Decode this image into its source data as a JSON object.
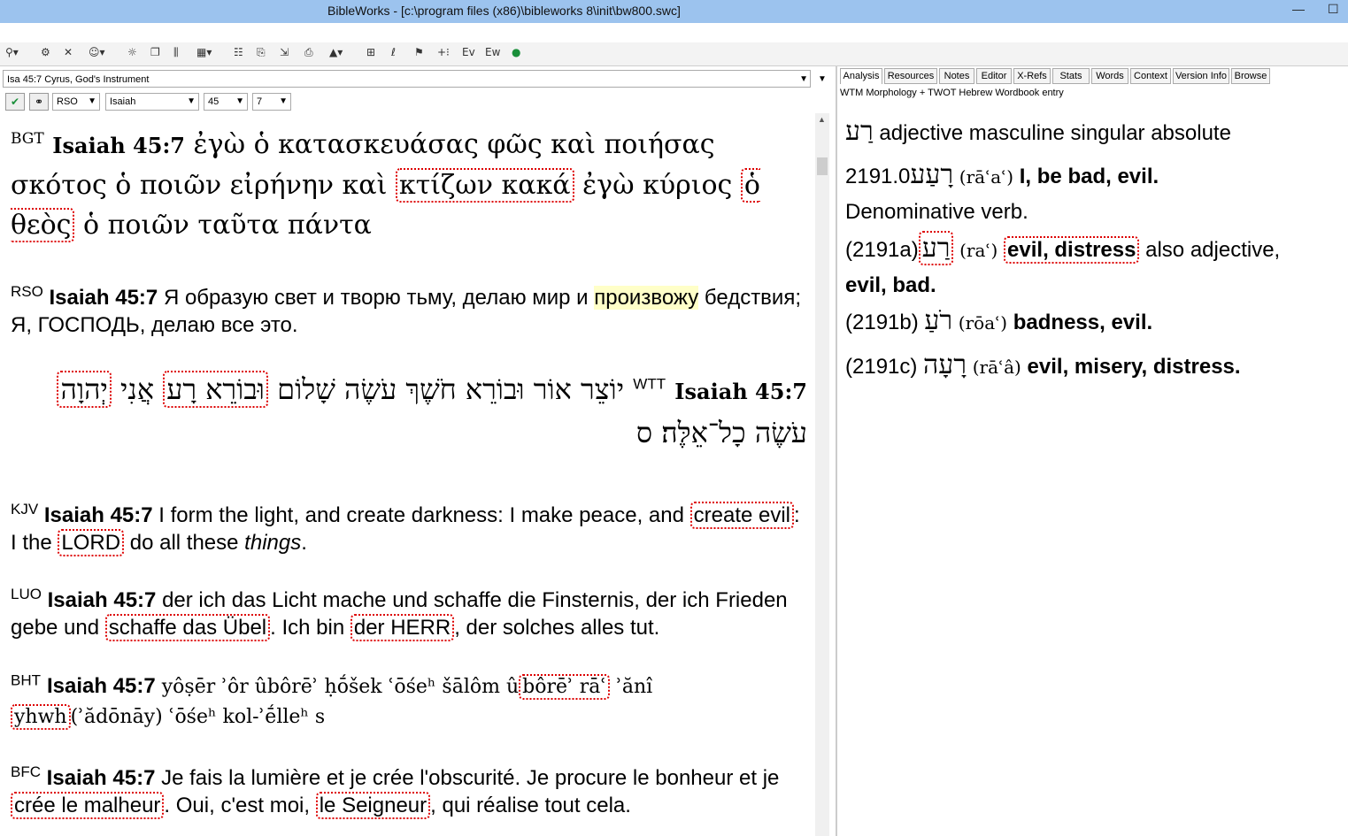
{
  "window": {
    "title": "BibleWorks - [c:\\program files (x86)\\bibleworks 8\\init\\bw800.swc]"
  },
  "reference_box": {
    "value": "Isa 45:7 Cyrus, God's Instrument"
  },
  "selectors": {
    "version": "RSO",
    "book": "Isaiah",
    "chapter": "45",
    "verse": "7"
  },
  "tabs": [
    "Analysis",
    "Resources",
    "Notes",
    "Editor",
    "X-Refs",
    "Stats",
    "Words",
    "Context",
    "Version Info",
    "Browse"
  ],
  "analysis": {
    "entry_title": "WTM Morphology + TWOT Hebrew Wordbook entry",
    "head_word": "רַע",
    "parse": "adjective masculine singular absolute",
    "l1_num": "2191.0",
    "l1_heb": "רָעַע",
    "l1_tr": "(rāʿaʿ)",
    "l1_def": "I, be bad, evil.",
    "l2": "Denominative verb.",
    "l3_num": "(2191a)",
    "l3_heb": "רַע",
    "l3_tr": "(raʿ)",
    "l3_def": "evil, distress",
    "l3_rest": " also adjective,",
    "l4": "evil, bad.",
    "l5_num": "(2191b)",
    "l5_heb": "רֹעַ",
    "l5_tr": "(rōaʿ)",
    "l5_def": "badness, evil.",
    "l6_num": "(2191c)",
    "l6_heb": "רָעָה",
    "l6_tr": "(rāʿâ)",
    "l6_def": "evil, misery, distress."
  },
  "verses": {
    "bgt": {
      "ver": "BGT",
      "ref": "Isaiah 45:7",
      "t1": "ἐγὼ ὁ κατασκευάσας φῶς καὶ ποιήσας σκότος ὁ ποιῶν εἰρήνην καὶ",
      "h1": "κτίζων κακά",
      "t2": "ἐγὼ κύριος",
      "h2": "ὁ θεὸς",
      "t3": "ὁ ποιῶν ταῦτα πάντα"
    },
    "rso": {
      "ver": "RSO",
      "ref": "Isaiah 45:7",
      "t1": "Я образую свет и творю тьму, делаю мир и",
      "y1": "произвожу",
      "t2": "бедствия; Я, ГОСПОДЬ, делаю все это."
    },
    "wtt": {
      "ver": "WTT",
      "ref": "Isaiah 45:7",
      "t1": "יוֹצֵר אוֹר וּבוֹרֵא חֹשֶׁךְ עֹשֶׂה שָׁלוֹם",
      "h1": "וּבוֹרֵא רָע",
      "t2": "אֲנִי",
      "h2": "יְהוָה",
      "t3": "עֹשֶׂה כָל־אֵלֶּה׃ ס"
    },
    "kjv": {
      "ver": "KJV",
      "ref": "Isaiah 45:7",
      "t1": "I form the light, and create darkness: I make peace, and",
      "h1": "create evil",
      "t2": ": I the",
      "h2": "LORD",
      "t3": "do all these",
      "i1": "things",
      "t4": "."
    },
    "luo": {
      "ver": "LUO",
      "ref": "Isaiah 45:7",
      "t1": "der ich das Licht mache und schaffe die Finsternis, der ich Frieden gebe und",
      "h1": "schaffe das Übel",
      "t2": ". Ich bin",
      "h2": "der HERR",
      "t3": ", der solches alles tut."
    },
    "bht": {
      "ver": "BHT",
      "ref": "Isaiah 45:7",
      "t1": "yôṣēr ʾôr ûbôrēʾ ḥṓšek ʿōśeʰ šālôm û",
      "h1": "bôrēʾ rāʿ",
      "t2": "ʾănî",
      "h2": "yhwh",
      "t3": "(ʾădōnāy) ʿōśeʰ kol-ʾḗlleʰ s"
    },
    "bfc": {
      "ver": "BFC",
      "ref": "Isaiah 45:7",
      "t1": "Je fais la lumière et je crée l'obscurité. Je procure le bonheur et je",
      "h1": "crée le malheur",
      "t2": ". Oui, c'est moi,",
      "h2": "le Seigneur",
      "t3": ", qui réalise tout cela."
    }
  }
}
